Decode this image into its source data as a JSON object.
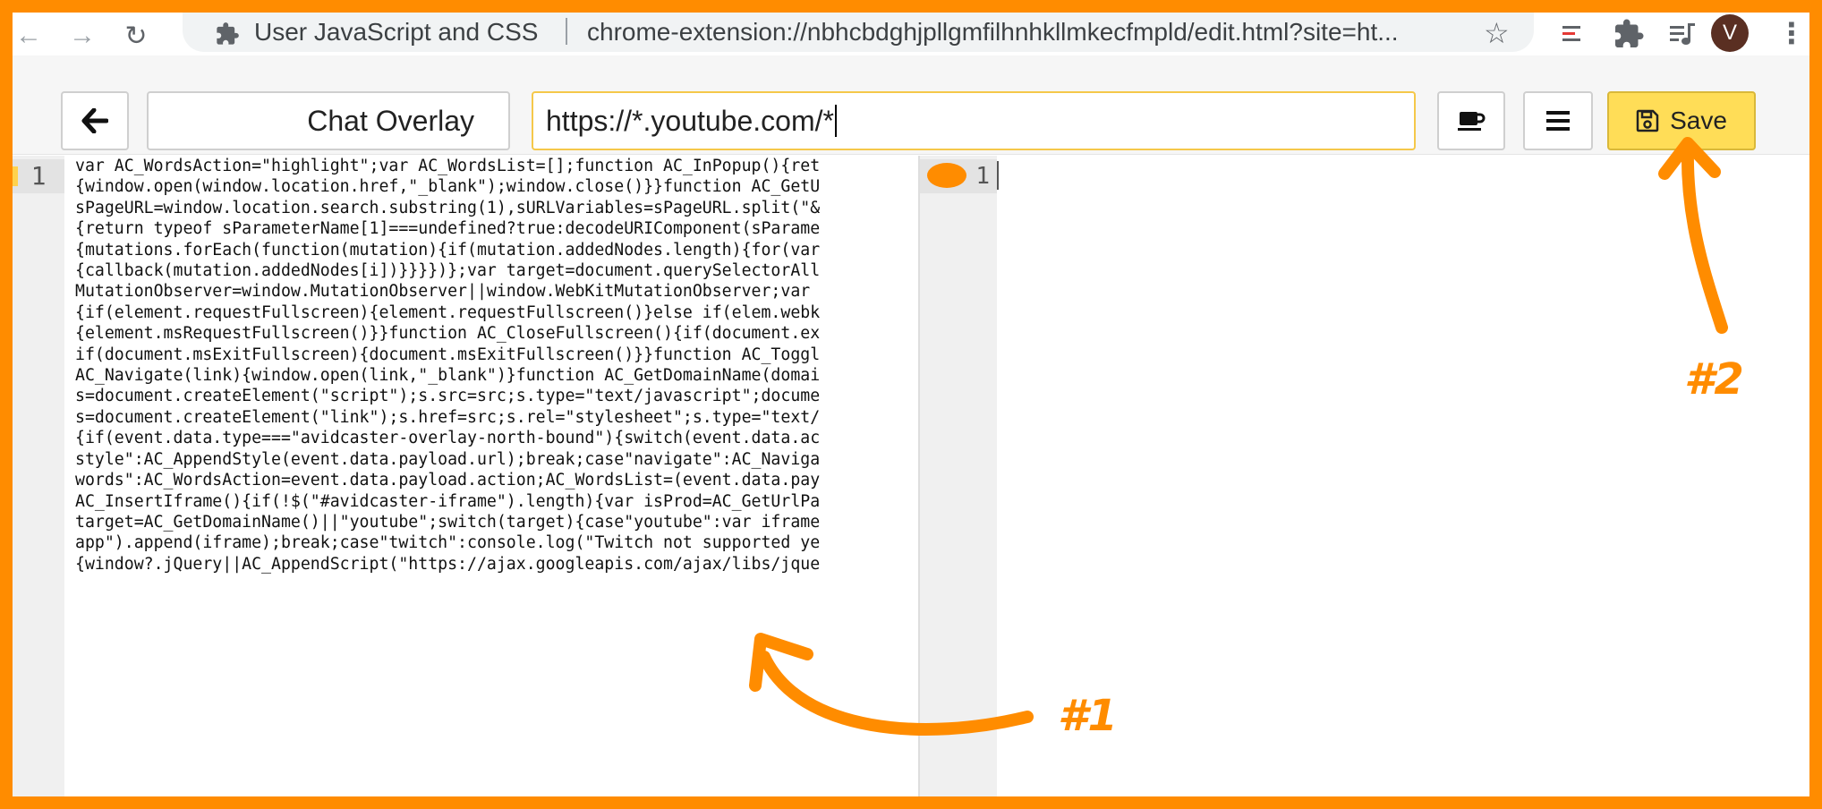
{
  "browser": {
    "tab_title": "User JavaScript and CSS",
    "url": "chrome-extension://nbhcbdghjpllgmfilhnhkllmkecfmpld/edit.html?site=ht...",
    "avatar_letter": "V"
  },
  "toolbar": {
    "script_name": "Chat Overlay",
    "url_pattern": "https://*.youtube.com/*",
    "save_label": "Save"
  },
  "editor_js": {
    "line_number": "1",
    "lines": [
      "var AC_WordsAction=\"highlight\";var AC_WordsList=[];function AC_InPopup(){ret",
      "{window.open(window.location.href,\"_blank\");window.close()}}function AC_GetU",
      "sPageURL=window.location.search.substring(1),sURLVariables=sPageURL.split(\"&",
      "{return typeof sParameterName[1]===undefined?true:decodeURIComponent(sParame",
      "{mutations.forEach(function(mutation){if(mutation.addedNodes.length){for(var",
      "{callback(mutation.addedNodes[i])}}}})};var target=document.querySelectorAll",
      "MutationObserver=window.MutationObserver||window.WebKitMutationObserver;var ",
      "{if(element.requestFullscreen){element.requestFullscreen()}else if(elem.webk",
      "{element.msRequestFullscreen()}}function AC_CloseFullscreen(){if(document.ex",
      "if(document.msExitFullscreen){document.msExitFullscreen()}}function AC_Toggl",
      "AC_Navigate(link){window.open(link,\"_blank\")}function AC_GetDomainName(domai",
      "s=document.createElement(\"script\");s.src=src;s.type=\"text/javascript\";docume",
      "s=document.createElement(\"link\");s.href=src;s.rel=\"stylesheet\";s.type=\"text/",
      "{if(event.data.type===\"avidcaster-overlay-north-bound\"){switch(event.data.ac",
      "style\":AC_AppendStyle(event.data.payload.url);break;case\"navigate\":AC_Naviga",
      "words\":AC_WordsAction=event.data.payload.action;AC_WordsList=(event.data.pay",
      "AC_InsertIframe(){if(!$(\"#avidcaster-iframe\").length){var isProd=AC_GetUrlPa",
      "target=AC_GetDomainName()||\"youtube\";switch(target){case\"youtube\":var iframe",
      "app\").append(iframe);break;case\"twitch\":console.log(\"Twitch not supported ye",
      "{window?.jQuery||AC_AppendScript(\"https://ajax.googleapis.com/ajax/libs/jque"
    ]
  },
  "editor_css": {
    "line_number": "1"
  },
  "annotations": {
    "label_1": "#1",
    "label_2": "#2",
    "color": "#ff8c00"
  }
}
